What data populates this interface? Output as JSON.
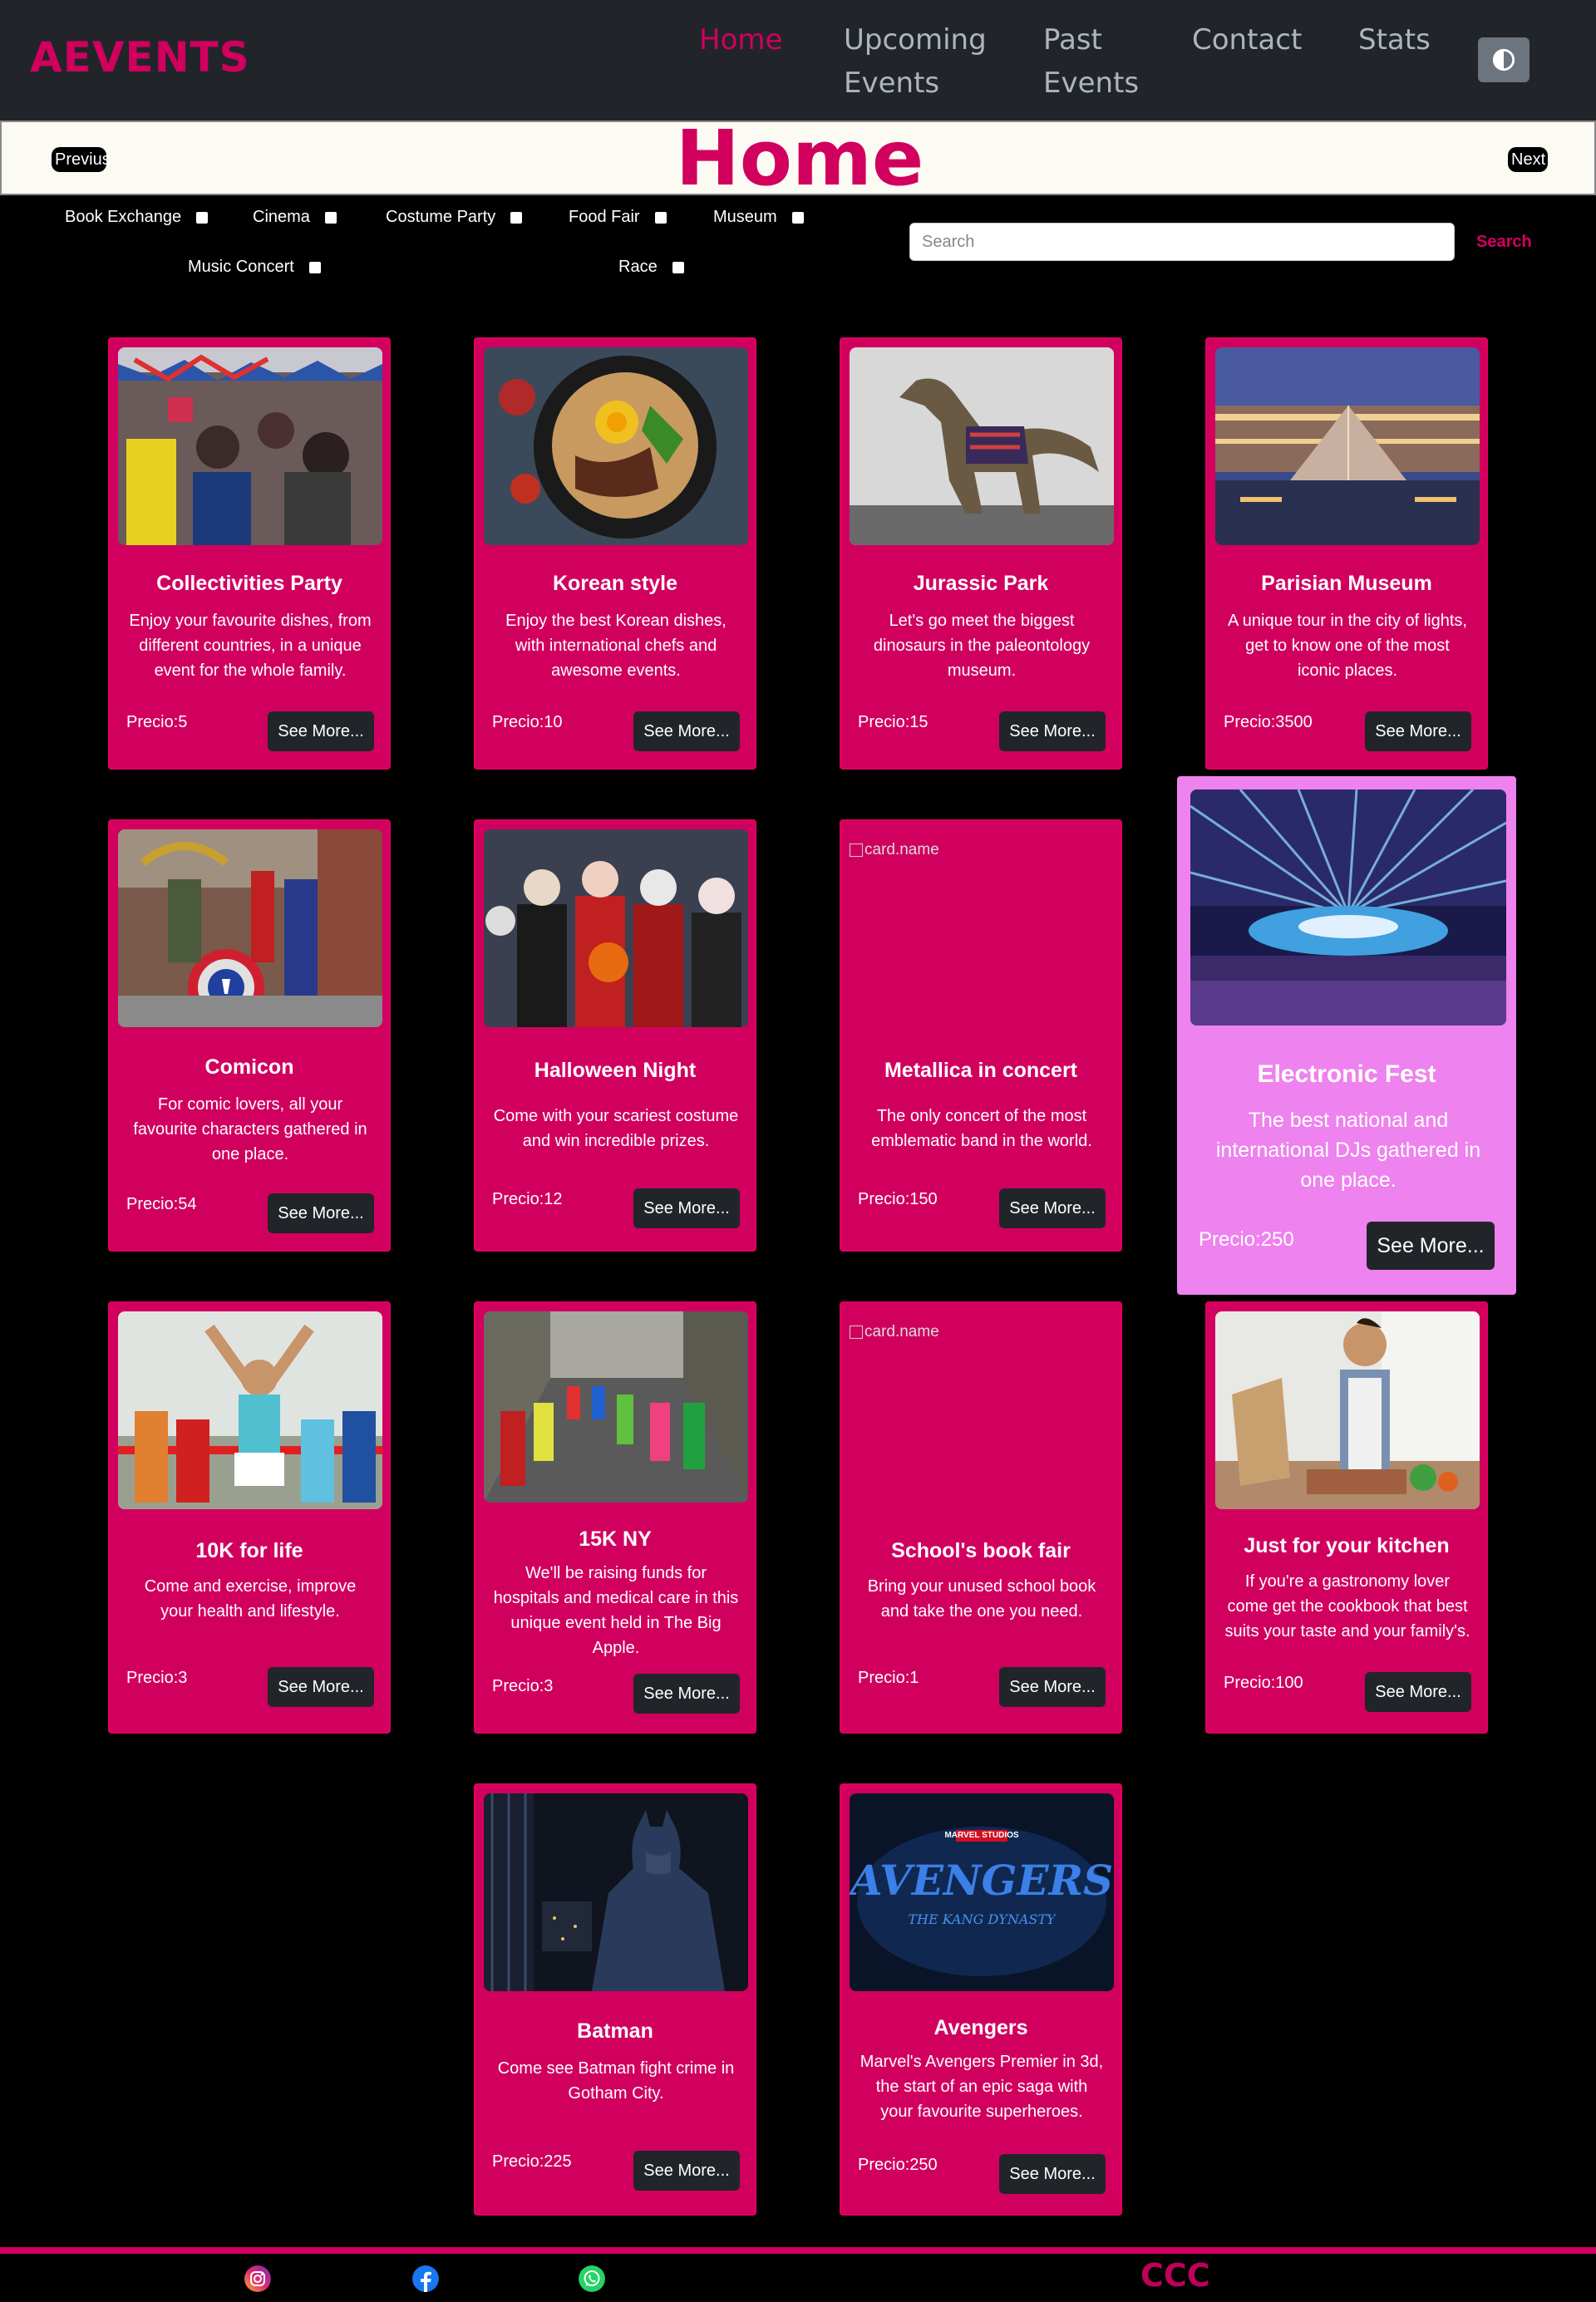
{
  "brand": {
    "logo_text_a": "A",
    "logo_text_rest": "EVENTS",
    "color": "#d1005f"
  },
  "nav": {
    "items": [
      {
        "line1": "Home",
        "line2": ""
      },
      {
        "line1": "Upcoming",
        "line2": "Events"
      },
      {
        "line1": "Past",
        "line2": "Events"
      },
      {
        "line1": "Contact",
        "line2": ""
      },
      {
        "line1": "Stats",
        "line2": ""
      }
    ],
    "theme_toggle_icon": "contrast-icon"
  },
  "header": {
    "title": "Home",
    "prev_label": "Previus",
    "next_label": "Next"
  },
  "filters": [
    {
      "label": "Book Exchange"
    },
    {
      "label": "Cinema"
    },
    {
      "label": "Costume Party"
    },
    {
      "label": "Food Fair"
    },
    {
      "label": "Museum"
    },
    {
      "label": "Music Concert"
    },
    {
      "label": "Race"
    }
  ],
  "search": {
    "placeholder": "Search",
    "button_label": "Search"
  },
  "cards": [
    {
      "title": "Collectivities Party",
      "desc": "Enjoy your favourite dishes, from different countries, in a unique event for the whole family.",
      "price": "Precio:5",
      "more": "See More..."
    },
    {
      "title": "Korean style",
      "desc": "Enjoy the best Korean dishes, with international chefs and awesome events.",
      "price": "Precio:10",
      "more": "See More..."
    },
    {
      "title": "Jurassic Park",
      "desc": "Let's go meet the biggest dinosaurs in the paleontology museum.",
      "price": "Precio:15",
      "more": "See More..."
    },
    {
      "title": "Parisian Museum",
      "desc": "A unique tour in the city of lights, get to know one of the most iconic places.",
      "price": "Precio:3500",
      "more": "See More..."
    },
    {
      "title": "Comicon",
      "desc": "For comic lovers, all your favourite characters gathered in one place.",
      "price": "Precio:54",
      "more": "See More..."
    },
    {
      "title": "Halloween Night",
      "desc": "Come with your scariest costume and win incredible prizes.",
      "price": "Precio:12",
      "more": "See More..."
    },
    {
      "title": "Metallica in concert",
      "desc": "The only concert of the most emblematic band in the world.",
      "price": "Precio:150",
      "more": "See More...",
      "img_alt": "card.name"
    },
    {
      "title": "Electronic Fest",
      "desc": "The best national and international DJs gathered in one place.",
      "price": "Precio:250",
      "more": "See More..."
    },
    {
      "title": "10K for life",
      "desc": "Come and exercise, improve your health and lifestyle.",
      "price": "Precio:3",
      "more": "See More..."
    },
    {
      "title": "15K NY",
      "desc": "We'll be raising funds for hospitals and medical care in this unique event held in The Big Apple.",
      "price": "Precio:3",
      "more": "See More..."
    },
    {
      "title": "School's book fair",
      "desc": "Bring your unused school book and take the one you need.",
      "price": "Precio:1",
      "more": "See More...",
      "img_alt": "card.name"
    },
    {
      "title": "Just for your kitchen",
      "desc": "If you're a gastronomy lover come get the cookbook that best suits your taste and your family's.",
      "price": "Precio:100",
      "more": "See More..."
    },
    {
      "title": "Batman",
      "desc": "Come see Batman fight crime in Gotham City.",
      "price": "Precio:225",
      "more": "See More..."
    },
    {
      "title": "Avengers",
      "desc": "Marvel's Avengers Premier in 3d, the start of an epic saga with your favourite superheroes.",
      "price": "Precio:250",
      "more": "See More...",
      "img_text_top": "MARVEL STUDIOS",
      "img_text_main": "AVENGERS",
      "img_text_sub": "THE KANG DYNASTY"
    }
  ],
  "footer": {
    "social": [
      "instagram-icon",
      "facebook-icon",
      "whatsapp-icon"
    ],
    "brand": "CCC"
  }
}
